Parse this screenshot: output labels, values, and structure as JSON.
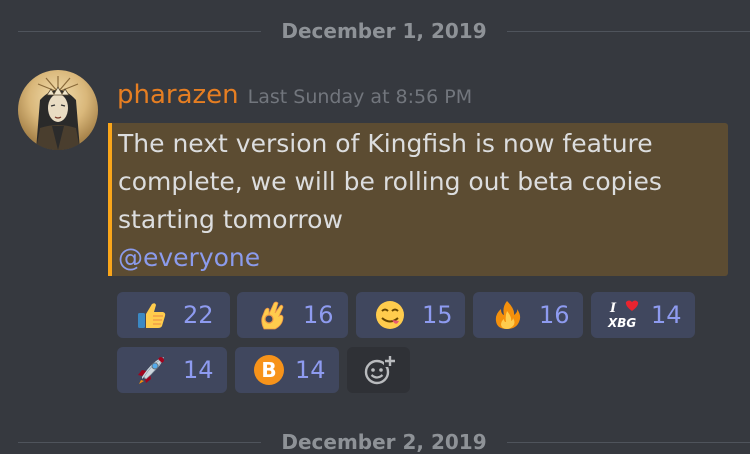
{
  "date_divider_top": "December 1, 2019",
  "date_divider_bottom": "December 2, 2019",
  "message": {
    "username": "pharazen",
    "timestamp": "Last Sunday at 8:56 PM",
    "text": "The next version of Kingfish is now feature complete, we will be rolling out beta copies starting tomorrow",
    "mention": "@everyone"
  },
  "reactions": [
    {
      "emoji": "thumbs-up-icon",
      "count": "22"
    },
    {
      "emoji": "ok-hand-icon",
      "count": "16"
    },
    {
      "emoji": "savoring-food-face-icon",
      "count": "15"
    },
    {
      "emoji": "fire-icon",
      "count": "16"
    },
    {
      "emoji": "i-love-xbg-icon",
      "count": "14",
      "icon_text_top": "I",
      "icon_text_bottom": "XBG"
    },
    {
      "emoji": "rocket-icon",
      "count": "14"
    },
    {
      "emoji": "bitcoin-icon",
      "count": "14",
      "icon_text": "B"
    }
  ],
  "add_reaction": {
    "icon": "add-reaction-icon"
  },
  "colors": {
    "background": "#36393f",
    "username": "#e67e22",
    "mention_highlight_bg": "#5c4c32",
    "mention_highlight_border": "#faa61a",
    "mention_text": "#8b9bec",
    "reaction_bg": "#40475e",
    "reaction_count": "#8e9bf0"
  }
}
